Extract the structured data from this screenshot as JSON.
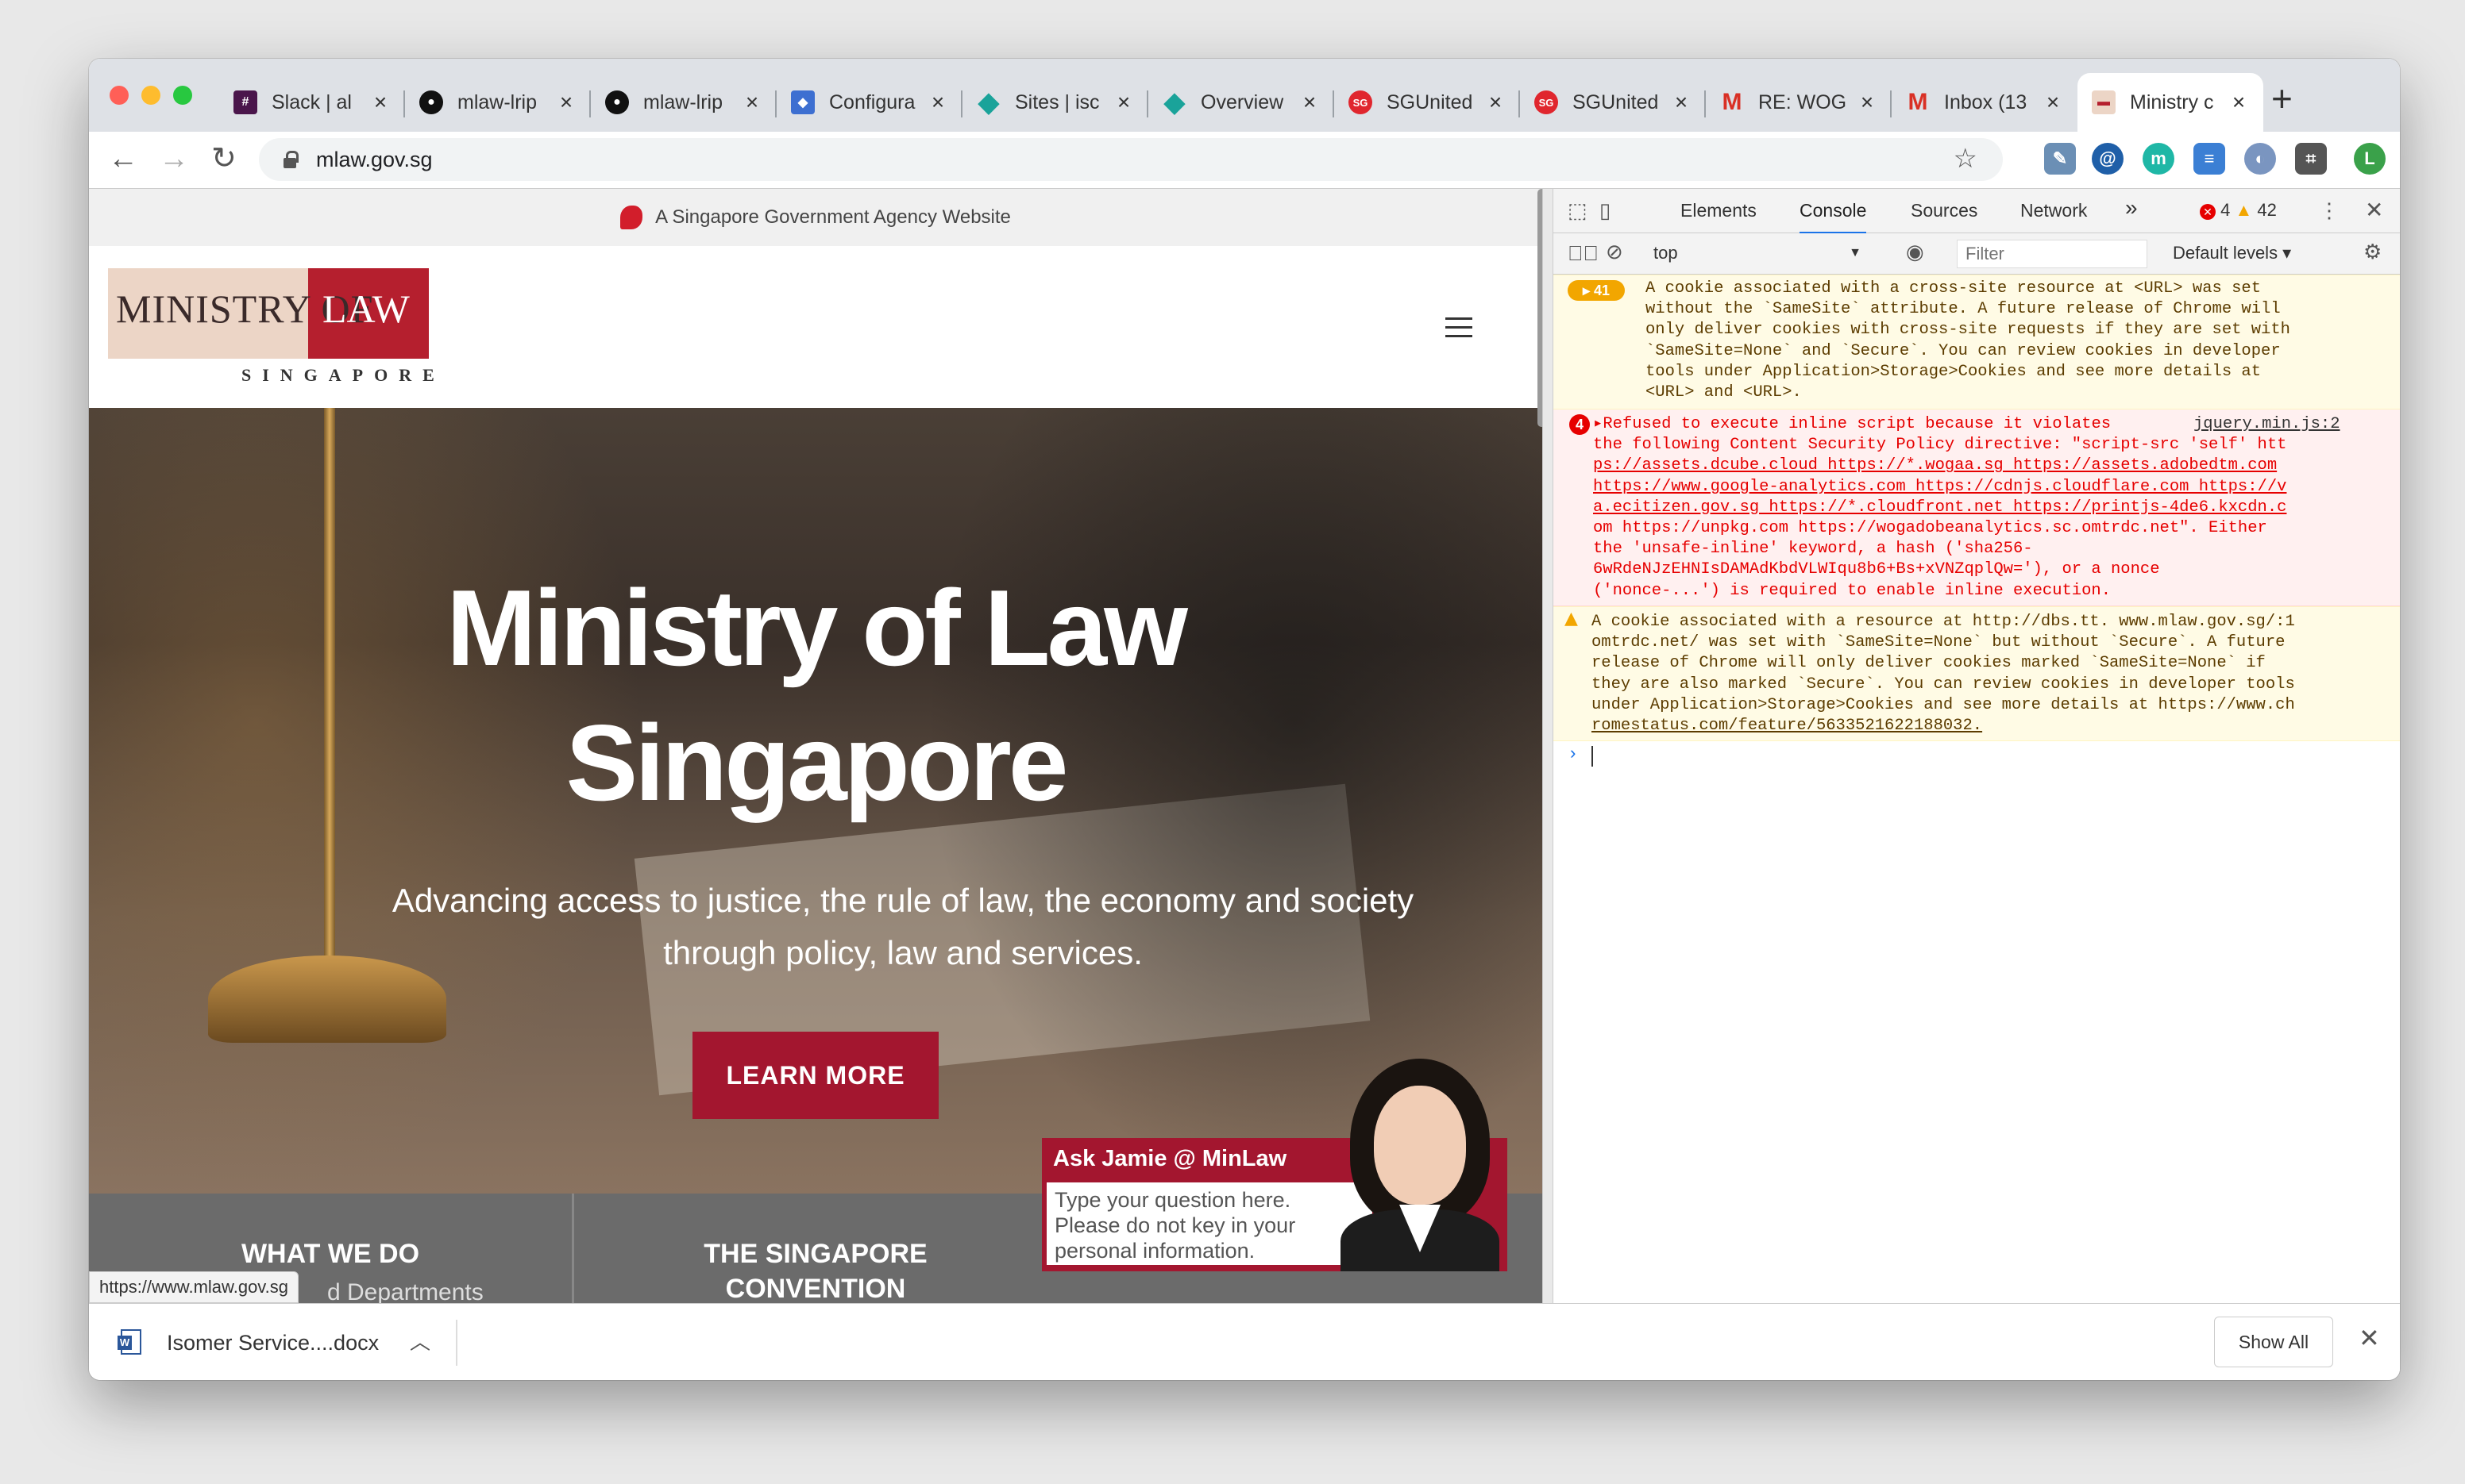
{
  "browser": {
    "tabs": [
      {
        "title": "Slack | al",
        "favicon": "slack-icon",
        "color": "#4a154b"
      },
      {
        "title": "mlaw-lrip",
        "favicon": "github-icon",
        "color": "#111111"
      },
      {
        "title": "mlaw-lrip",
        "favicon": "github-icon",
        "color": "#111111"
      },
      {
        "title": "Configura",
        "favicon": "cube-icon",
        "color": "#3d6fd1"
      },
      {
        "title": "Sites | isc",
        "favicon": "diamond-icon",
        "color": "#1aa39a"
      },
      {
        "title": "Overview",
        "favicon": "diamond-icon",
        "color": "#1aa39a"
      },
      {
        "title": "SGUnited",
        "favicon": "sg-icon",
        "color": "#e0262e"
      },
      {
        "title": "SGUnited",
        "favicon": "sg-icon",
        "color": "#e0262e"
      },
      {
        "title": "RE: WOG",
        "favicon": "gmail-icon",
        "color": "#d93025"
      },
      {
        "title": "Inbox (13",
        "favicon": "gmail-icon",
        "color": "#d93025"
      },
      {
        "title": "Ministry c",
        "favicon": "mlaw-icon",
        "color": "#b51f2e"
      }
    ],
    "new_tab": "+",
    "url": "mlaw.gov.sg",
    "profile_initial": "L",
    "status_url": "https://www.mlaw.gov.sg"
  },
  "page": {
    "gov_banner": "A Singapore Government Agency Website",
    "logo": {
      "line1": "MINISTRY OF",
      "line2": "LAW",
      "sub": "SINGAPORE"
    },
    "hero": {
      "title_line1": "Ministry of Law",
      "title_line2": "Singapore",
      "subtitle_line1": "Advancing access to justice, the rule of law, the economy and society",
      "subtitle_line2": "through policy, law and services.",
      "cta": "LEARN MORE"
    },
    "nav": [
      {
        "label": "WHAT WE DO",
        "sub": "d Departments"
      },
      {
        "label_line1": "THE SINGAPORE",
        "label_line2": "CONVENTION"
      }
    ],
    "chat": {
      "title": "Ask Jamie @ MinLaw",
      "placeholder_line1": "Type your question here.",
      "placeholder_line2": "Please do not key in your",
      "placeholder_line3": "personal information."
    }
  },
  "devtools": {
    "tabs": [
      "Elements",
      "Console",
      "Sources",
      "Network",
      "»"
    ],
    "active_tab": "Console",
    "error_count": "4",
    "warning_count": "42",
    "context": "top",
    "filter_placeholder": "Filter",
    "levels": "Default levels ▾",
    "messages": [
      {
        "type": "warning",
        "badge": "41",
        "lines": [
          "A cookie associated with a cross-site resource at <URL> was set",
          "without the `SameSite` attribute. A future release of Chrome will",
          "only deliver cookies with cross-site requests if they are set with",
          "`SameSite=None` and `Secure`. You can review cookies in developer",
          "tools under Application>Storage>Cookies and see more details at",
          "<URL> and <URL>."
        ]
      },
      {
        "type": "error",
        "badge": "4",
        "source": "jquery.min.js:2",
        "lines": [
          "▸Refused to execute inline script because it violates",
          "the following Content Security Policy directive: \"script-src 'self' htt",
          "ps://assets.dcube.cloud https://*.wogaa.sg https://assets.adobedtm.com",
          "https://www.google-analytics.com https://cdnjs.cloudflare.com https://v",
          "a.ecitizen.gov.sg https://*.cloudfront.net https://printjs-4de6.kxcdn.c",
          "om https://unpkg.com https://wogadobeanalytics.sc.omtrdc.net\". Either",
          "the 'unsafe-inline' keyword, a hash ('sha256-",
          "6wRdeNJzEHNIsDAMAdKbdVLWIqu8b6+Bs+xVNZqplQw='), or a nonce",
          "('nonce-...') is required to enable inline execution."
        ]
      },
      {
        "type": "warning",
        "lines": [
          "A cookie associated with a resource at http://dbs.tt. www.mlaw.gov.sg/:1",
          "omtrdc.net/ was set with `SameSite=None` but without `Secure`. A future",
          "release of Chrome will only deliver cookies marked `SameSite=None` if",
          "they are also marked `Secure`. You can review cookies in developer tools",
          "under Application>Storage>Cookies and see more details at https://www.ch",
          "romestatus.com/feature/5633521622188032."
        ]
      }
    ],
    "prompt": "›"
  },
  "downloads": {
    "file": "Isomer Service....docx",
    "show_all": "Show All",
    "close": "✕"
  },
  "colors": {
    "brand_red": "#a3162f",
    "devtools_accent": "#1a73e8",
    "error_red": "#e60000",
    "warning_bg": "#fffbe5"
  }
}
